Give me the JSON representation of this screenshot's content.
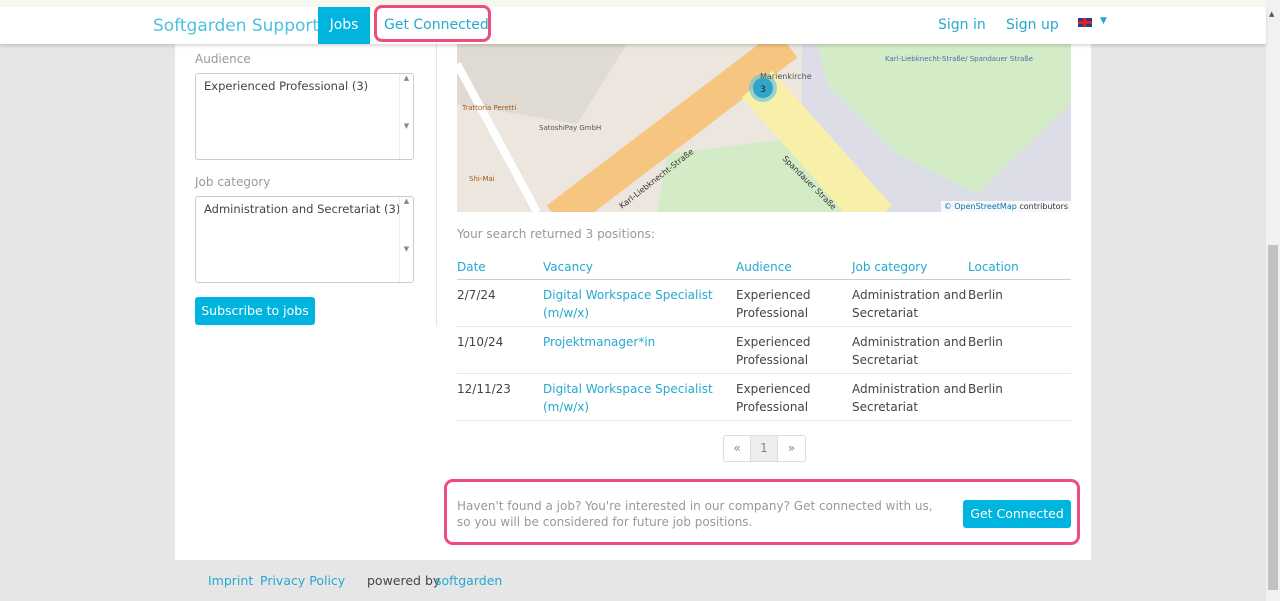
{
  "nav": {
    "brand": "Softgarden Support",
    "jobs": "Jobs",
    "get_connected": "Get Connected",
    "sign_in": "Sign in",
    "sign_up": "Sign up",
    "language": "English (UK)"
  },
  "filters": {
    "audience_label": "Audience",
    "audience_option": "Experienced Professional (3)",
    "category_label": "Job category",
    "category_option": "Administration and Secretariat (3)",
    "subscribe": "Subscribe to jobs"
  },
  "map": {
    "cluster_count": "3",
    "attribution_prefix": "©",
    "attribution_link": "OpenStreetMap",
    "attribution_suffix": "contributors",
    "labels": [
      "Marienkirche",
      "Karl-Liebknecht-Straße/ Spandauer Straße",
      "Trattoria Peretti",
      "SatoshiPay GmbH",
      "Shi-Mai",
      "Karl-Liebknecht-Straße",
      "Spandauer Straße"
    ]
  },
  "results": {
    "summary": "Your search returned 3 positions:",
    "headers": [
      "Date",
      "Vacancy",
      "Audience",
      "Job category",
      "Location"
    ],
    "rows": [
      {
        "date": "2/7/24",
        "vacancy": "Digital Workspace Specialist (m/w/x)",
        "audience": "Experienced Professional",
        "category": "Administration and Secretariat",
        "location": "Berlin"
      },
      {
        "date": "1/10/24",
        "vacancy": "Projektmanager*in",
        "audience": "Experienced Professional",
        "category": "Administration and Secretariat",
        "location": "Berlin"
      },
      {
        "date": "12/11/23",
        "vacancy": "Digital Workspace Specialist (m/w/x)",
        "audience": "Experienced Professional",
        "category": "Administration and Secretariat",
        "location": "Berlin"
      }
    ]
  },
  "pagination": {
    "prev": "«",
    "current": "1",
    "next": "»"
  },
  "cta": {
    "text": "Haven't found a job? You're interested in our company? Get connected with us, so you will be considered for future job positions.",
    "button": "Get Connected"
  },
  "footer": {
    "imprint": "Imprint",
    "privacy": "Privacy Policy",
    "powered": "powered by",
    "powered_link": "softgarden"
  }
}
